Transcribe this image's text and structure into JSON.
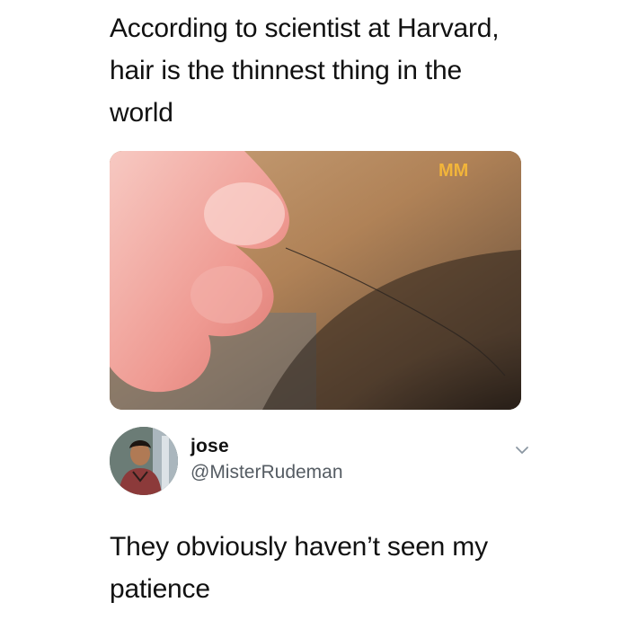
{
  "post": {
    "text": "According to scientist at Harvard,\nhair is the thinnest thing in the\nworld",
    "media": {
      "watermark": "MM",
      "subject": "fingers pinching a single strand of hair"
    }
  },
  "reply": {
    "author": {
      "name": "jose",
      "handle": "@MisterRudeman"
    },
    "text": "They obviously haven’t seen my\npatience",
    "menu_icon": "chevron-down-icon"
  }
}
